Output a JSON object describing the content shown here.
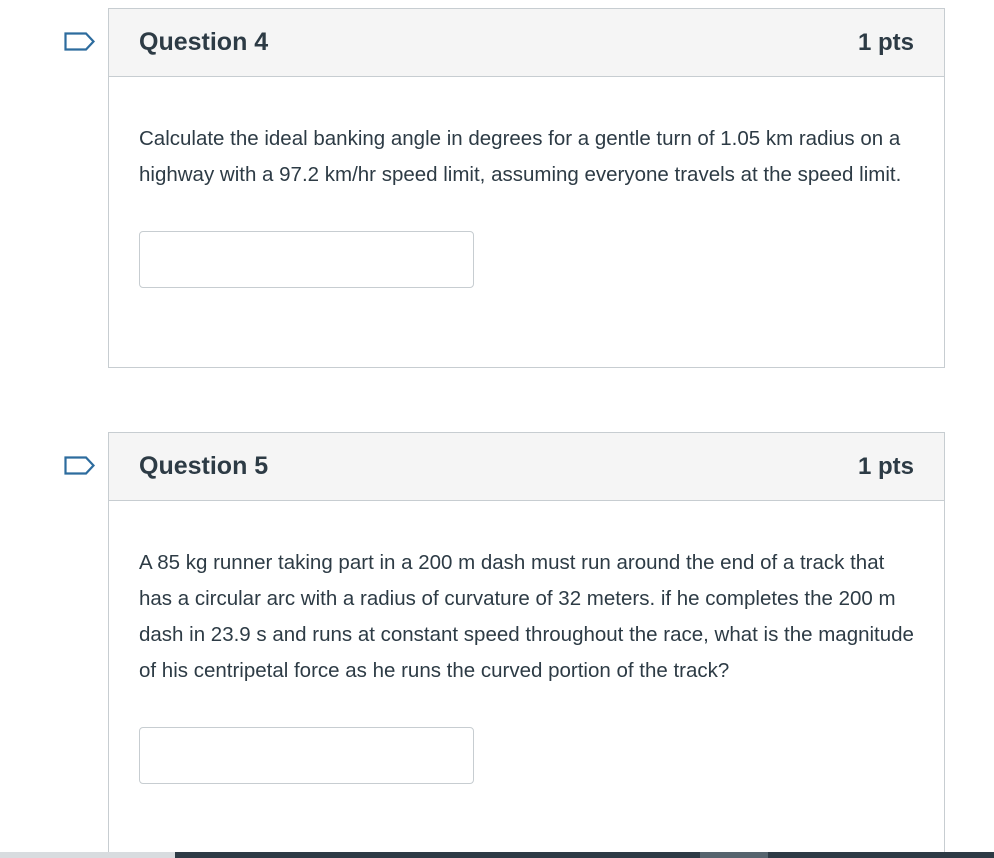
{
  "questions": [
    {
      "title": "Question 4",
      "points": "1 pts",
      "text": "Calculate the ideal banking angle in degrees for a gentle turn of 1.05 km radius on a highway with a 97.2 km/hr speed limit, assuming everyone travels at the speed limit.",
      "answer_value": "",
      "flag_icon": "flag-outline-icon"
    },
    {
      "title": "Question 5",
      "points": "1 pts",
      "text": "A 85 kg runner taking part in a 200 m dash must run around the end of a track that has a circular arc with a radius of curvature of 32 meters.  if he completes the 200 m dash in 23.9 s and runs at constant speed throughout the race, what is the magnitude of his centripetal force as he runs the curved portion of the track?",
      "answer_value": "",
      "flag_icon": "flag-outline-icon"
    }
  ],
  "colors": {
    "text": "#2d3b45",
    "border": "#c7cdd1",
    "header_bg": "#f5f5f5",
    "flag": "#2d6c9e"
  }
}
